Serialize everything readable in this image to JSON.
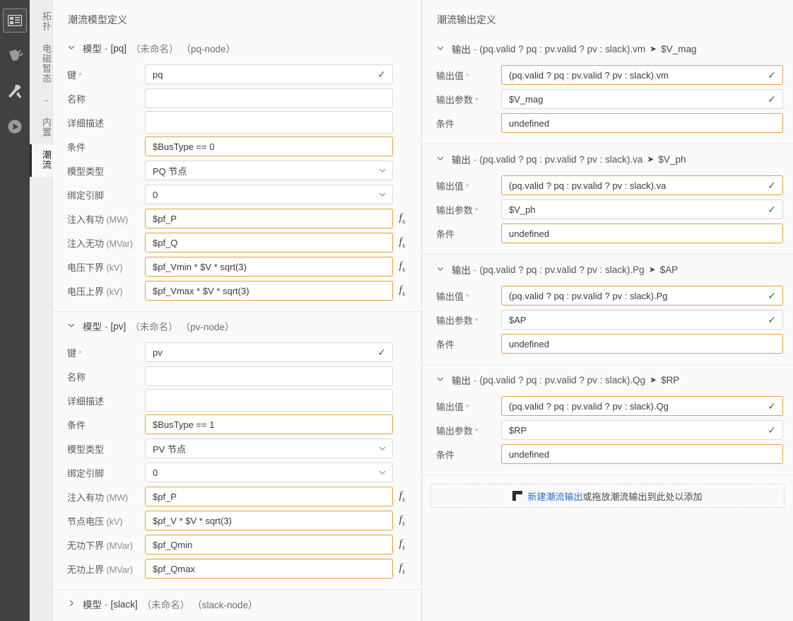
{
  "rail": {
    "items": [
      {
        "name": "layout-icon",
        "active": true
      },
      {
        "name": "plug-icon",
        "active": false
      },
      {
        "name": "tools-icon",
        "active": false
      },
      {
        "name": "run-icon",
        "active": false
      }
    ]
  },
  "tabs": [
    {
      "label": "拓扑",
      "active": false
    },
    {
      "label": "电磁暂态 - 内置",
      "active": false
    },
    {
      "label": "潮流",
      "active": true
    }
  ],
  "left": {
    "title": "潮流模型定义",
    "models": [
      {
        "expanded": true,
        "prefix": "模型",
        "dash": "-",
        "key_tag": "[pq]",
        "name_tag": "（未命名）",
        "type_tag": "（pq-node）",
        "fields": [
          {
            "label": "键",
            "required": true,
            "value": "pq",
            "kind": "text",
            "highlight": false,
            "check": true,
            "fx": false
          },
          {
            "label": "名称",
            "required": false,
            "value": "",
            "kind": "text",
            "highlight": false,
            "check": false,
            "fx": false
          },
          {
            "label": "详细描述",
            "required": false,
            "value": "",
            "kind": "textarea",
            "highlight": false,
            "check": false,
            "fx": false
          },
          {
            "label": "条件",
            "required": false,
            "value": "$BusType == 0",
            "kind": "text",
            "highlight": true,
            "check": false,
            "fx": false
          },
          {
            "label": "模型类型",
            "required": false,
            "value": "PQ 节点",
            "kind": "select",
            "highlight": false,
            "check": false,
            "fx": false
          },
          {
            "label": "绑定引脚",
            "required": false,
            "value": "0",
            "kind": "select",
            "highlight": false,
            "check": false,
            "fx": false
          },
          {
            "label": "注入有功",
            "unit": "(MW)",
            "required": false,
            "value": "$pf_P",
            "kind": "text",
            "highlight": true,
            "check": false,
            "fx": true
          },
          {
            "label": "注入无功",
            "unit": "(MVar)",
            "required": false,
            "value": "$pf_Q",
            "kind": "text",
            "highlight": true,
            "check": false,
            "fx": true
          },
          {
            "label": "电压下界",
            "unit": "(kV)",
            "required": false,
            "value": "$pf_Vmin * $V * sqrt(3)",
            "kind": "text",
            "highlight": true,
            "check": false,
            "fx": true
          },
          {
            "label": "电压上界",
            "unit": "(kV)",
            "required": false,
            "value": "$pf_Vmax * $V * sqrt(3)",
            "kind": "text",
            "highlight": true,
            "check": false,
            "fx": true
          }
        ]
      },
      {
        "expanded": true,
        "prefix": "模型",
        "dash": "-",
        "key_tag": "[pv]",
        "name_tag": "（未命名）",
        "type_tag": "（pv-node）",
        "fields": [
          {
            "label": "键",
            "required": true,
            "value": "pv",
            "kind": "text",
            "highlight": false,
            "check": true,
            "fx": false
          },
          {
            "label": "名称",
            "required": false,
            "value": "",
            "kind": "text",
            "highlight": false,
            "check": false,
            "fx": false
          },
          {
            "label": "详细描述",
            "required": false,
            "value": "",
            "kind": "textarea",
            "highlight": false,
            "check": false,
            "fx": false
          },
          {
            "label": "条件",
            "required": false,
            "value": "$BusType == 1",
            "kind": "text",
            "highlight": true,
            "check": false,
            "fx": false
          },
          {
            "label": "模型类型",
            "required": false,
            "value": "PV 节点",
            "kind": "select",
            "highlight": false,
            "check": false,
            "fx": false
          },
          {
            "label": "绑定引脚",
            "required": false,
            "value": "0",
            "kind": "select",
            "highlight": false,
            "check": false,
            "fx": false
          },
          {
            "label": "注入有功",
            "unit": "(MW)",
            "required": false,
            "value": "$pf_P",
            "kind": "text",
            "highlight": true,
            "check": false,
            "fx": true
          },
          {
            "label": "节点电压",
            "unit": "(kV)",
            "required": false,
            "value": "$pf_V * $V * sqrt(3)",
            "kind": "text",
            "highlight": true,
            "check": false,
            "fx": true
          },
          {
            "label": "无功下界",
            "unit": "(MVar)",
            "required": false,
            "value": "$pf_Qmin",
            "kind": "text",
            "highlight": true,
            "check": false,
            "fx": true
          },
          {
            "label": "无功上界",
            "unit": "(MVar)",
            "required": false,
            "value": "$pf_Qmax",
            "kind": "text",
            "highlight": true,
            "check": false,
            "fx": true
          }
        ]
      },
      {
        "expanded": false,
        "prefix": "模型",
        "dash": "-",
        "key_tag": "[slack]",
        "name_tag": "（未命名）",
        "type_tag": "（slack-node）",
        "fields": []
      }
    ]
  },
  "right": {
    "title": "潮流输出定义",
    "field_labels": {
      "value": "输出值",
      "param": "输出参数",
      "condition": "条件"
    },
    "outputs": [
      {
        "expanded": true,
        "prefix": "输出",
        "dash": "-",
        "expr": "(pq.valid ? pq : pv.valid ? pv : slack).vm",
        "arrow": "➤",
        "target": "$V_mag",
        "value": "(pq.valid ? pq : pv.valid ? pv : slack).vm",
        "param": "$V_mag",
        "condition": "undefined"
      },
      {
        "expanded": true,
        "prefix": "输出",
        "dash": "-",
        "expr": "(pq.valid ? pq : pv.valid ? pv : slack).va",
        "arrow": "➤",
        "target": "$V_ph",
        "value": "(pq.valid ? pq : pv.valid ? pv : slack).va",
        "param": "$V_ph",
        "condition": "undefined"
      },
      {
        "expanded": true,
        "prefix": "输出",
        "dash": "-",
        "expr": "(pq.valid ? pq : pv.valid ? pv : slack).Pg",
        "arrow": "➤",
        "target": "$AP",
        "value": "(pq.valid ? pq : pv.valid ? pv : slack).Pg",
        "param": "$AP",
        "condition": "undefined"
      },
      {
        "expanded": true,
        "prefix": "输出",
        "dash": "-",
        "expr": "(pq.valid ? pq : pv.valid ? pv : slack).Qg",
        "arrow": "➤",
        "target": "$RP",
        "value": "(pq.valid ? pq : pv.valid ? pv : slack).Qg",
        "param": "$RP",
        "condition": "undefined"
      }
    ],
    "dropzone": {
      "link": "新建潮流输出",
      "rest": "或拖放潮流输出到此处以添加"
    }
  },
  "colors": {
    "highlight_border": "#e2a338",
    "check_green": "#1e7a45",
    "link_blue": "#2f6fd0",
    "rail_bg": "#414141",
    "panel_bg": "#fafafa"
  }
}
